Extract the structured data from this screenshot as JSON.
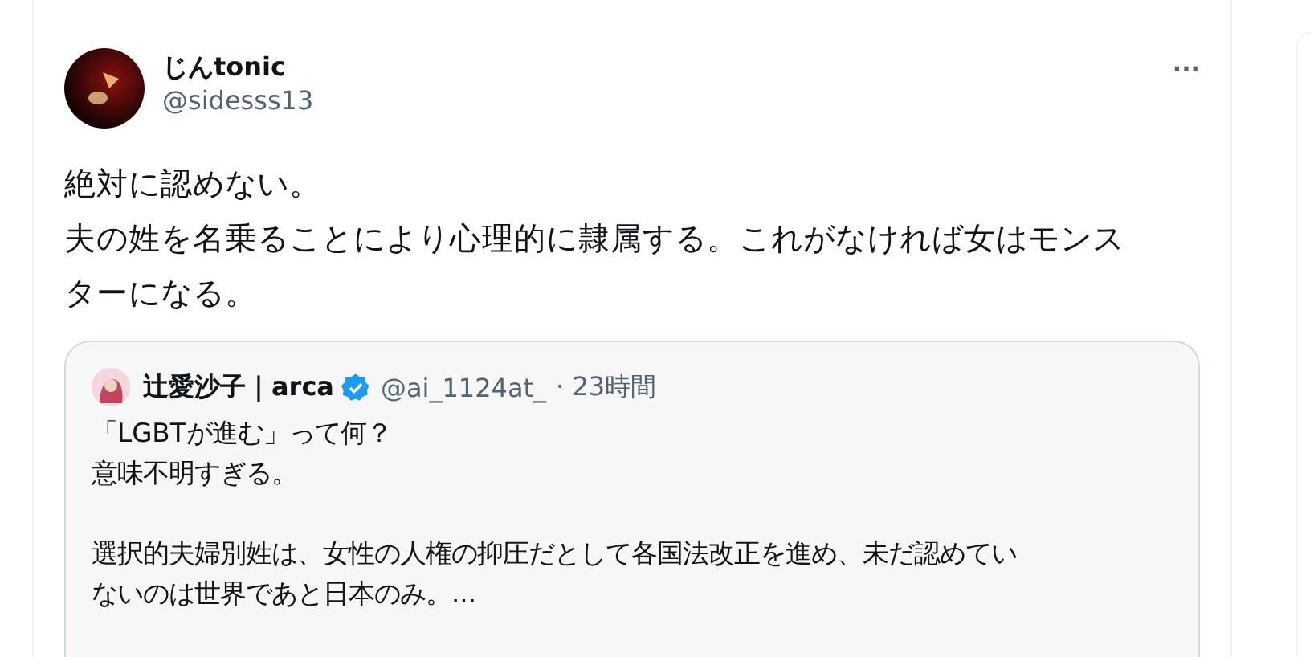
{
  "tweet": {
    "author": {
      "name": "じんtonic",
      "handle": "@sidesss13"
    },
    "more": "···",
    "lines": [
      "絶対に認めない。",
      "夫の姓を名乗ることにより心理的に隷属する。これがなければ女はモンス",
      "ターになる。"
    ],
    "quote": {
      "name": "辻愛沙子｜arca",
      "verified": true,
      "handle": "@ai_1124at_",
      "time": "· 23時間",
      "paragraphs": [
        [
          "「LGBTが進む」って何？",
          "意味不明すぎる。"
        ],
        [
          "選択的夫婦別姓は、女性の人権の抑圧だとして各国法改正を進め、未だ認めてい",
          "ないのは世界であと日本のみ。..."
        ]
      ]
    }
  }
}
